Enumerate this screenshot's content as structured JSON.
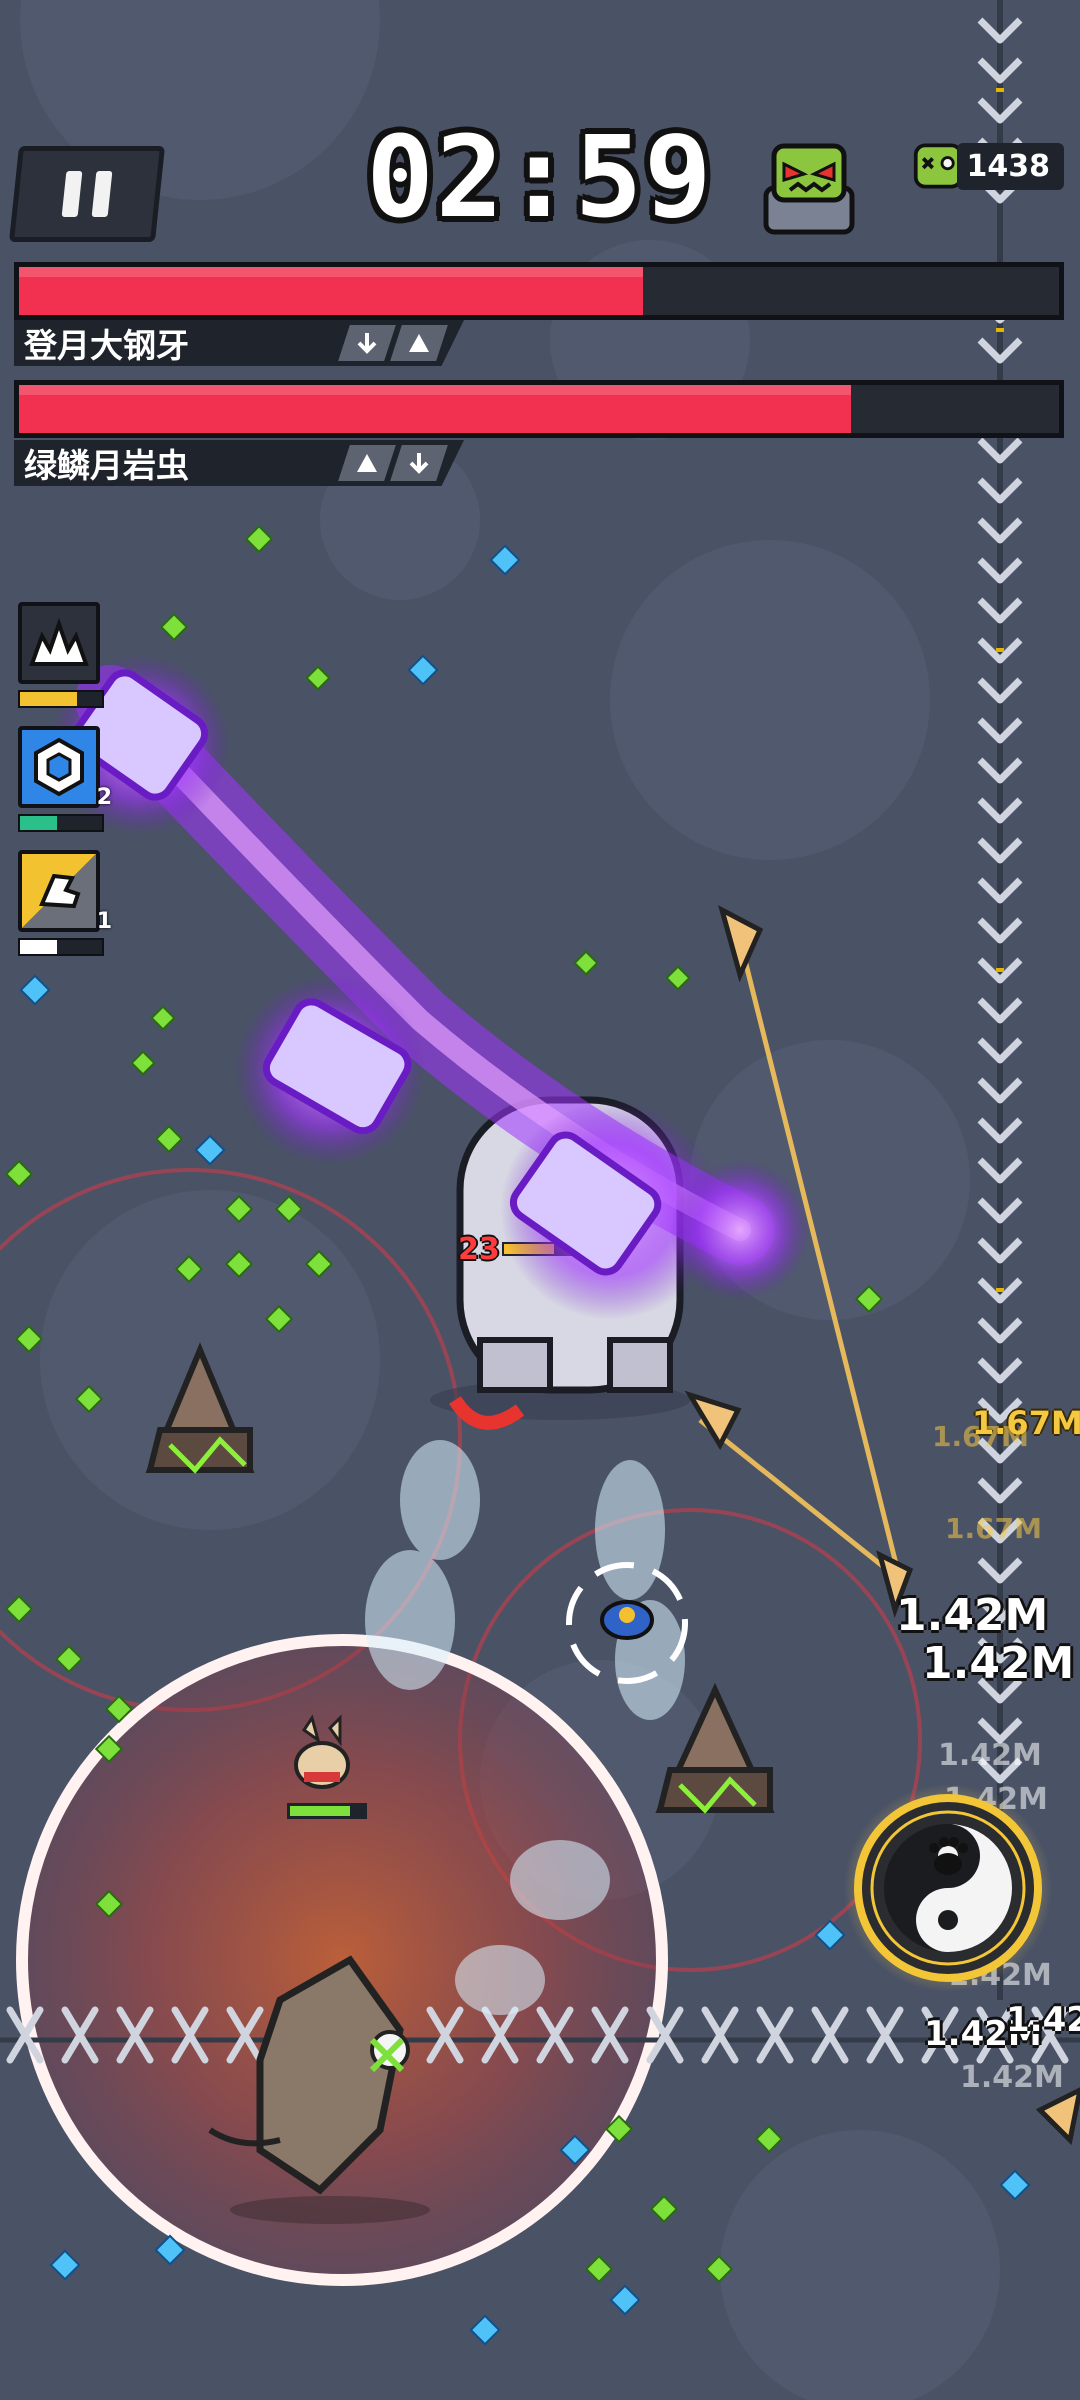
{
  "hud": {
    "timer": "02:59",
    "kill_count": "1438"
  },
  "bosses": [
    {
      "name": "登月大钢牙",
      "hp_fraction": 0.6
    },
    {
      "name": "绿鳞月岩虫",
      "hp_fraction": 0.8
    }
  ],
  "skills": [
    {
      "icon": "explosion-icon",
      "level": "",
      "progress": 0.7,
      "bar_color": "#f2c230"
    },
    {
      "icon": "shield-hex-icon",
      "level": "2",
      "progress": 0.45,
      "bar_color": "#2bbf8a"
    },
    {
      "icon": "speed-boot-icon",
      "level": "1",
      "progress": 0.45,
      "bar_color": "#ffffff"
    }
  ],
  "enemy_level": "23",
  "damage_numbers": {
    "gold": [
      "1.67M",
      "1.67M",
      "1.67M"
    ],
    "white": [
      "1.42M",
      "1.42M",
      "1.42M",
      "1.42M",
      "1.42M",
      "1.42M",
      "1.42M",
      "1.42"
    ]
  },
  "colors": {
    "hp_fill": "#f2304f",
    "gem_green": "#7ee03a",
    "gem_blue": "#4fc3f7",
    "laser_purple": "#b84dff"
  }
}
